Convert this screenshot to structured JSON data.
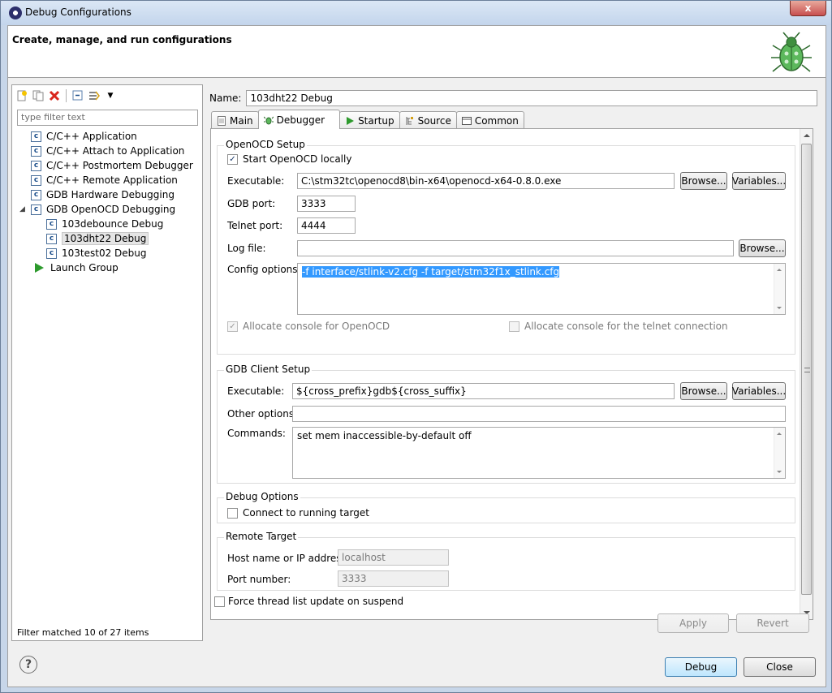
{
  "window": {
    "title": "Debug Configurations",
    "close_label": "x"
  },
  "header": {
    "title": "Create, manage, and run configurations"
  },
  "sidebar": {
    "filter_placeholder": "type filter text",
    "filter_status": "Filter matched 10 of 27 items",
    "items": [
      {
        "label": "C/C++ Application"
      },
      {
        "label": "C/C++ Attach to Application"
      },
      {
        "label": "C/C++ Postmortem Debugger"
      },
      {
        "label": "C/C++ Remote Application"
      },
      {
        "label": "GDB Hardware Debugging"
      },
      {
        "label": "GDB OpenOCD Debugging"
      },
      {
        "label": "103debounce Debug"
      },
      {
        "label": "103dht22 Debug"
      },
      {
        "label": "103test02 Debug"
      },
      {
        "label": "Launch Group"
      }
    ]
  },
  "name": {
    "label": "Name:",
    "value": "103dht22 Debug"
  },
  "tabs": [
    {
      "label": "Main"
    },
    {
      "label": "Debugger"
    },
    {
      "label": "Startup"
    },
    {
      "label": "Source"
    },
    {
      "label": "Common"
    }
  ],
  "openocd": {
    "title": "OpenOCD Setup",
    "start_locally_label": "Start OpenOCD locally",
    "executable_label": "Executable:",
    "executable_value": "C:\\stm32tc\\openocd8\\bin-x64\\openocd-x64-0.8.0.exe",
    "gdb_port_label": "GDB port:",
    "gdb_port_value": "3333",
    "telnet_port_label": "Telnet port:",
    "telnet_port_value": "4444",
    "log_file_label": "Log file:",
    "log_file_value": "",
    "config_label": "Config options:",
    "config_value": "-f interface/stlink-v2.cfg -f target/stm32f1x_stlink.cfg",
    "alloc_console_label": "Allocate console for OpenOCD",
    "alloc_telnet_label": "Allocate console for the telnet connection"
  },
  "gdb_client": {
    "title": "GDB Client Setup",
    "executable_label": "Executable:",
    "executable_value": "${cross_prefix}gdb${cross_suffix}",
    "other_options_label": "Other options:",
    "other_options_value": "",
    "commands_label": "Commands:",
    "commands_value": "set mem inaccessible-by-default off"
  },
  "debug_options": {
    "title": "Debug Options",
    "connect_label": "Connect to running target"
  },
  "remote_target": {
    "title": "Remote Target",
    "host_label": "Host name or IP address:",
    "host_value": "localhost",
    "port_label": "Port number:",
    "port_value": "3333"
  },
  "force_thread_label": "Force thread list update on suspend",
  "buttons": {
    "browse": "Browse...",
    "variables": "Variables...",
    "apply": "Apply",
    "revert": "Revert",
    "debug": "Debug",
    "close": "Close"
  },
  "help_label": "?"
}
